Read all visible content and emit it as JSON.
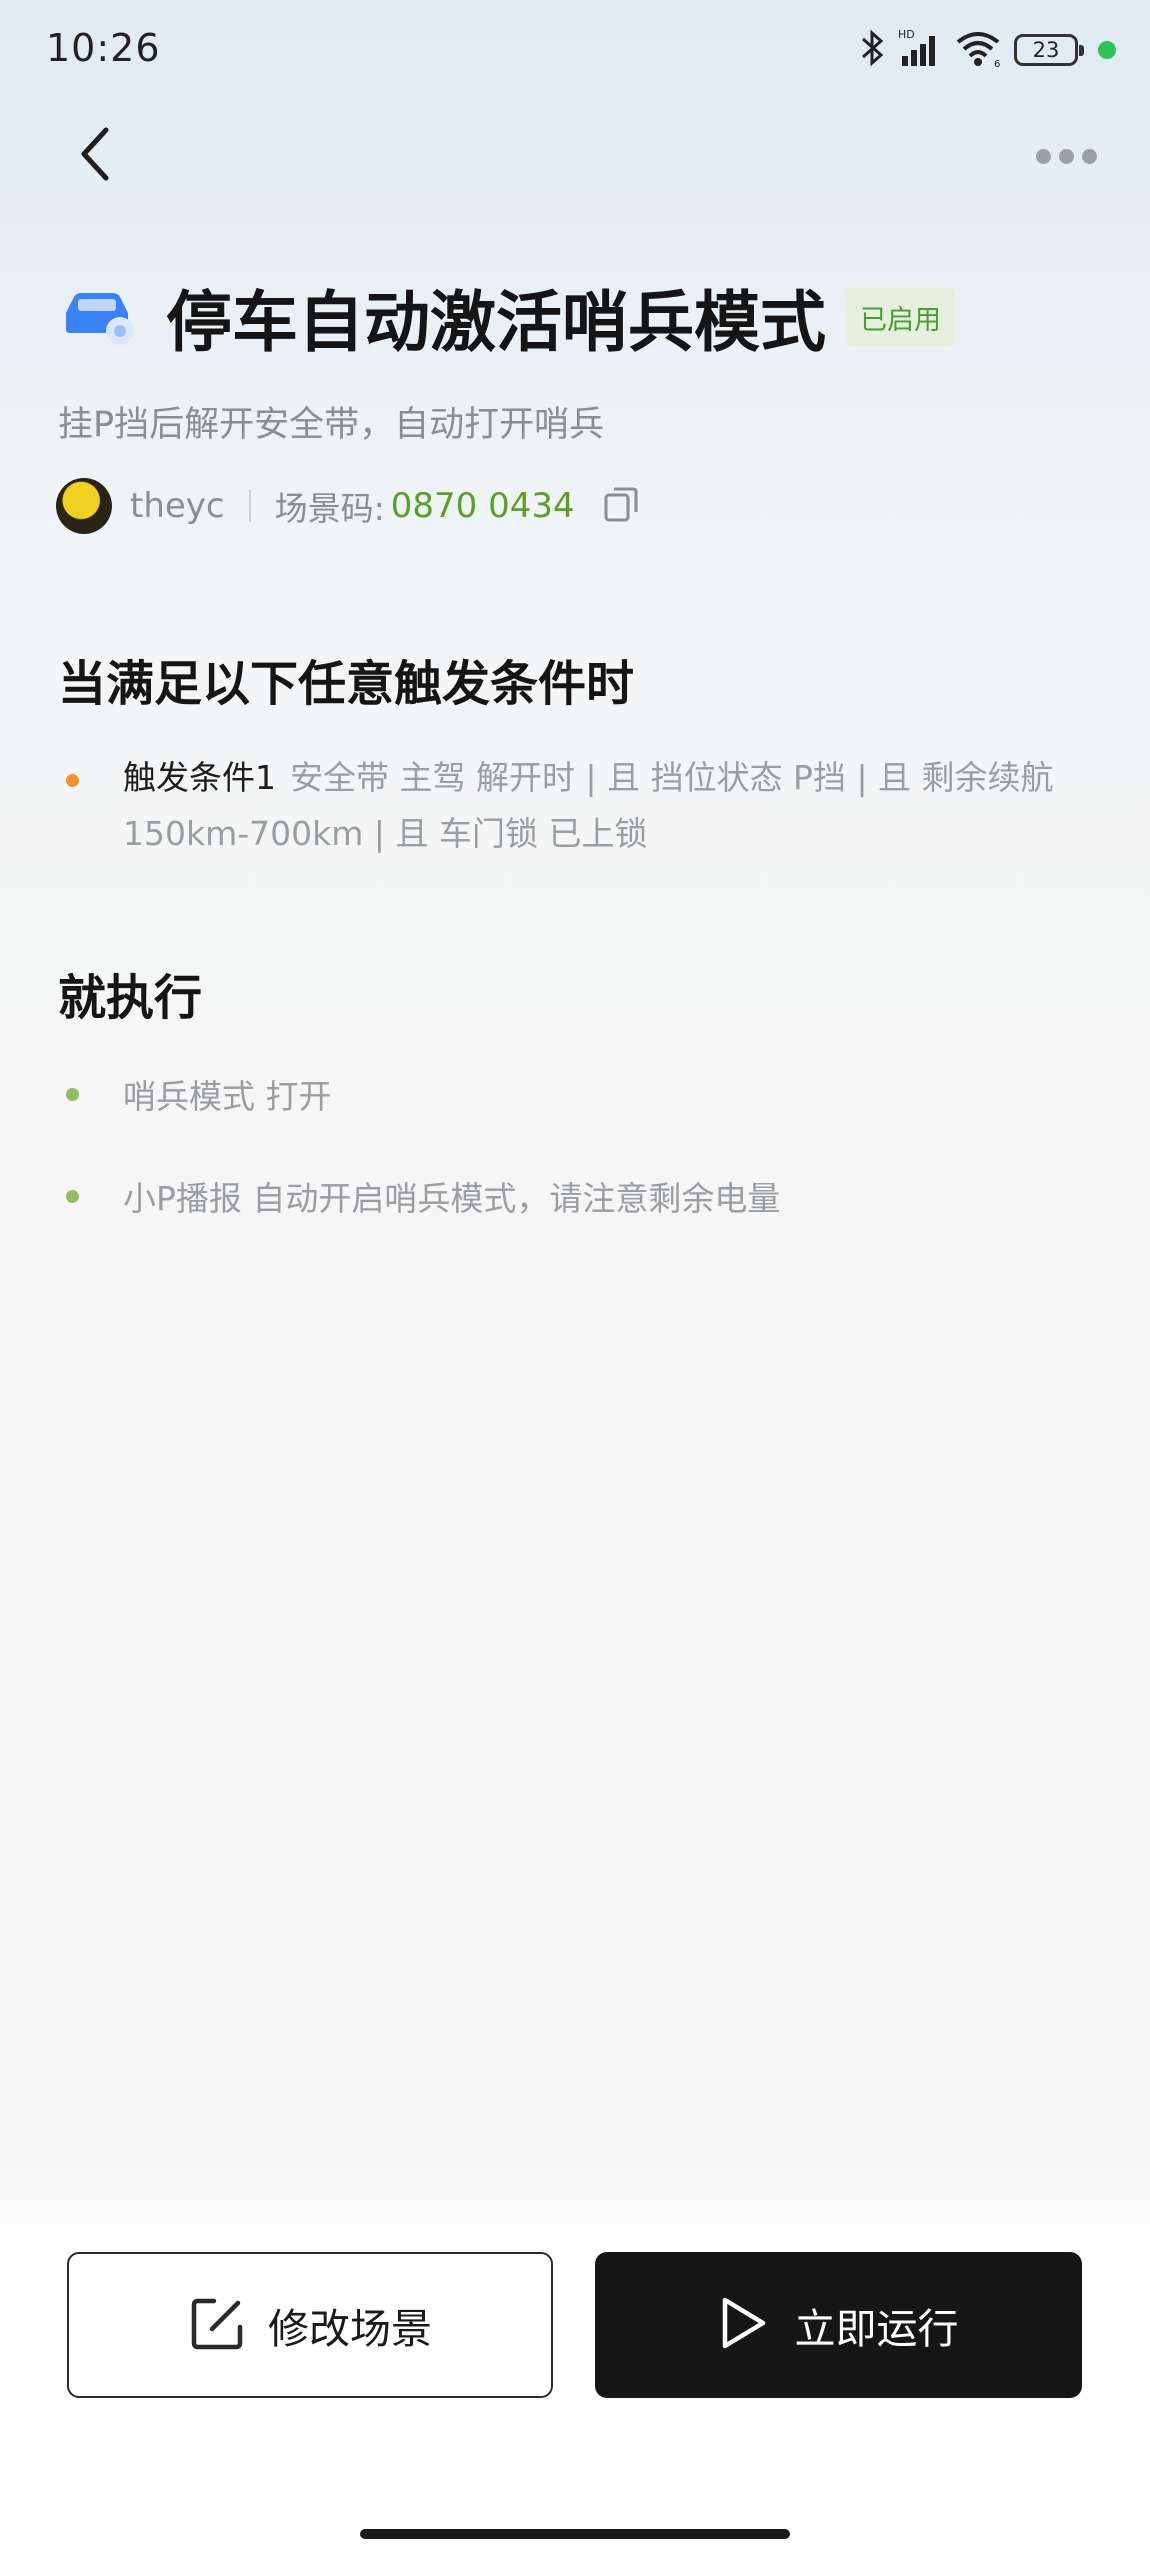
{
  "status_bar": {
    "time": "10:26",
    "battery": "23",
    "dot_color": "#2dc35a"
  },
  "header": {
    "title": "停车自动激活哨兵模式",
    "badge": "已启用",
    "subtitle": "挂P挡后解开安全带，自动打开哨兵",
    "author": "theyc",
    "scene_code_label": "场景码: ",
    "scene_code": "0870 0434"
  },
  "trigger_section": {
    "title": "当满足以下任意触发条件时",
    "items": [
      {
        "name": "触发条件1",
        "detail": "安全带 主驾 解开时 | 且 挡位状态 P挡 | 且 剩余续航 150km-700km | 且 车门锁 已上锁",
        "bullet_color": "#f0922e"
      }
    ]
  },
  "action_section": {
    "title": "就执行",
    "items": [
      {
        "text": "哨兵模式 打开",
        "bullet_color": "#8fbf62"
      },
      {
        "text": "小P播报 自动开启哨兵模式，请注意剩余电量",
        "bullet_color": "#8fbf62"
      }
    ]
  },
  "buttons": {
    "edit": "修改场景",
    "run": "立即运行"
  },
  "colors": {
    "accent_green": "#5aa025",
    "badge_bg": "#e4f0dd",
    "car_icon_blue": "#3b82f6"
  }
}
